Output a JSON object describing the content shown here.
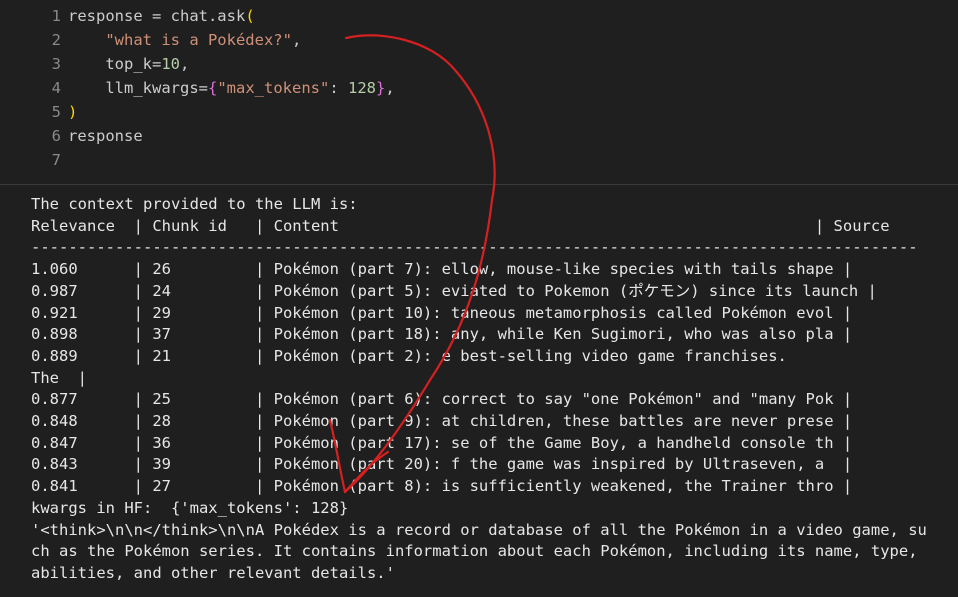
{
  "code": {
    "lines": [
      {
        "num": "1",
        "parts": [
          [
            "id",
            "response = chat.ask"
          ],
          [
            "brk",
            "("
          ]
        ]
      },
      {
        "num": "2",
        "parts": [
          [
            "id",
            "    "
          ],
          [
            "str",
            "\"what is a Pokédex?\""
          ],
          [
            "id",
            ","
          ]
        ]
      },
      {
        "num": "3",
        "parts": [
          [
            "id",
            "    top_k="
          ],
          [
            "num",
            "10"
          ],
          [
            "id",
            ","
          ]
        ]
      },
      {
        "num": "4",
        "parts": [
          [
            "id",
            "    llm_kwargs="
          ],
          [
            "brk2",
            "{"
          ],
          [
            "str",
            "\"max_tokens\""
          ],
          [
            "id",
            ": "
          ],
          [
            "num",
            "128"
          ],
          [
            "brk2",
            "}"
          ],
          [
            "id",
            ","
          ]
        ]
      },
      {
        "num": "5",
        "parts": [
          [
            "brk",
            ")"
          ]
        ]
      },
      {
        "num": "6",
        "parts": [
          [
            "id",
            "response"
          ]
        ]
      },
      {
        "num": "7",
        "parts": []
      }
    ]
  },
  "output": {
    "lines": [
      "The context provided to the LLM is:",
      "Relevance  | Chunk id   | Content                                                   | Source",
      "-----------------------------------------------------------------------------------------------",
      "1.060      | 26         | Pokémon (part 7): ellow, mouse-like species with tails shape |",
      "0.987      | 24         | Pokémon (part 5): eviated to Pokemon (ポケモン) since its launch |",
      "0.921      | 29         | Pokémon (part 10): taneous metamorphosis called Pokémon evol |",
      "0.898      | 37         | Pokémon (part 18): any, while Ken Sugimori, who was also pla |",
      "0.889      | 21         | Pokémon (part 2): e best-selling video game franchises.",
      "The  |",
      "0.877      | 25         | Pokémon (part 6): correct to say \"one Pokémon\" and \"many Pok |",
      "0.848      | 28         | Pokémon (part 9): at children, these battles are never prese |",
      "0.847      | 36         | Pokémon (part 17): se of the Game Boy, a handheld console th |",
      "0.843      | 39         | Pokémon (part 20): f the game was inspired by Ultraseven, a  |",
      "0.841      | 27         | Pokémon (part 8): is sufficiently weakened, the Trainer thro |",
      "kwargs in HF:  {'max_tokens': 128}",
      "'<think>\\n\\n</think>\\n\\nA Pokédex is a record or database of all the Pokémon in a video game, su",
      "ch as the Pokémon series. It contains information about each Pokémon, including its name, type,",
      "abilities, and other relevant details.'"
    ]
  },
  "colors": {
    "background": "#1f1f1f",
    "annotation": "#d42020"
  }
}
